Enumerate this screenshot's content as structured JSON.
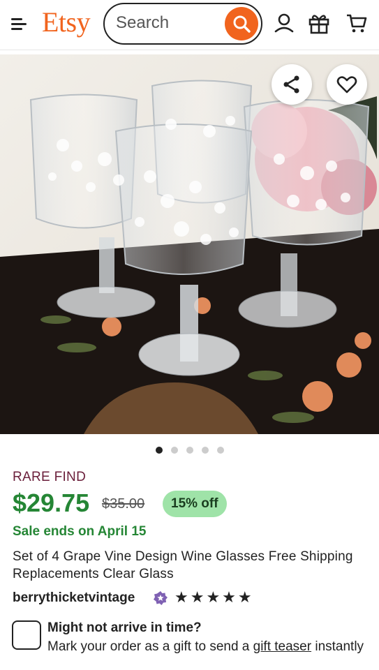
{
  "header": {
    "logo": "Etsy",
    "search_placeholder": "Search"
  },
  "gallery": {
    "dot_count": 5,
    "active_index": 0
  },
  "product": {
    "badge": "RARE FIND",
    "price": "$29.75",
    "original_price": "$35.00",
    "discount": "15% off",
    "sale_text": "Sale ends on April 15",
    "title": "Set of 4 Grape Vine Design Wine Glasses Free Shipping Replacements Clear Glass",
    "shop_name": "berrythicketvintage",
    "rating_stars": "★★★★★",
    "rating": 5
  },
  "gift": {
    "title": "Might not arrive in time?",
    "description_prefix": "Mark your order as a gift to send a ",
    "link_text": "gift teaser",
    "description_suffix": " instantly"
  },
  "colors": {
    "brand": "#f1641e",
    "price_green": "#258635",
    "badge_text": "#6a1e3a",
    "discount_bg": "#9fe3a8"
  },
  "icons": [
    "menu-icon",
    "search-icon",
    "account-icon",
    "gift-icon",
    "cart-icon",
    "share-icon",
    "heart-icon",
    "star-seller-icon"
  ]
}
